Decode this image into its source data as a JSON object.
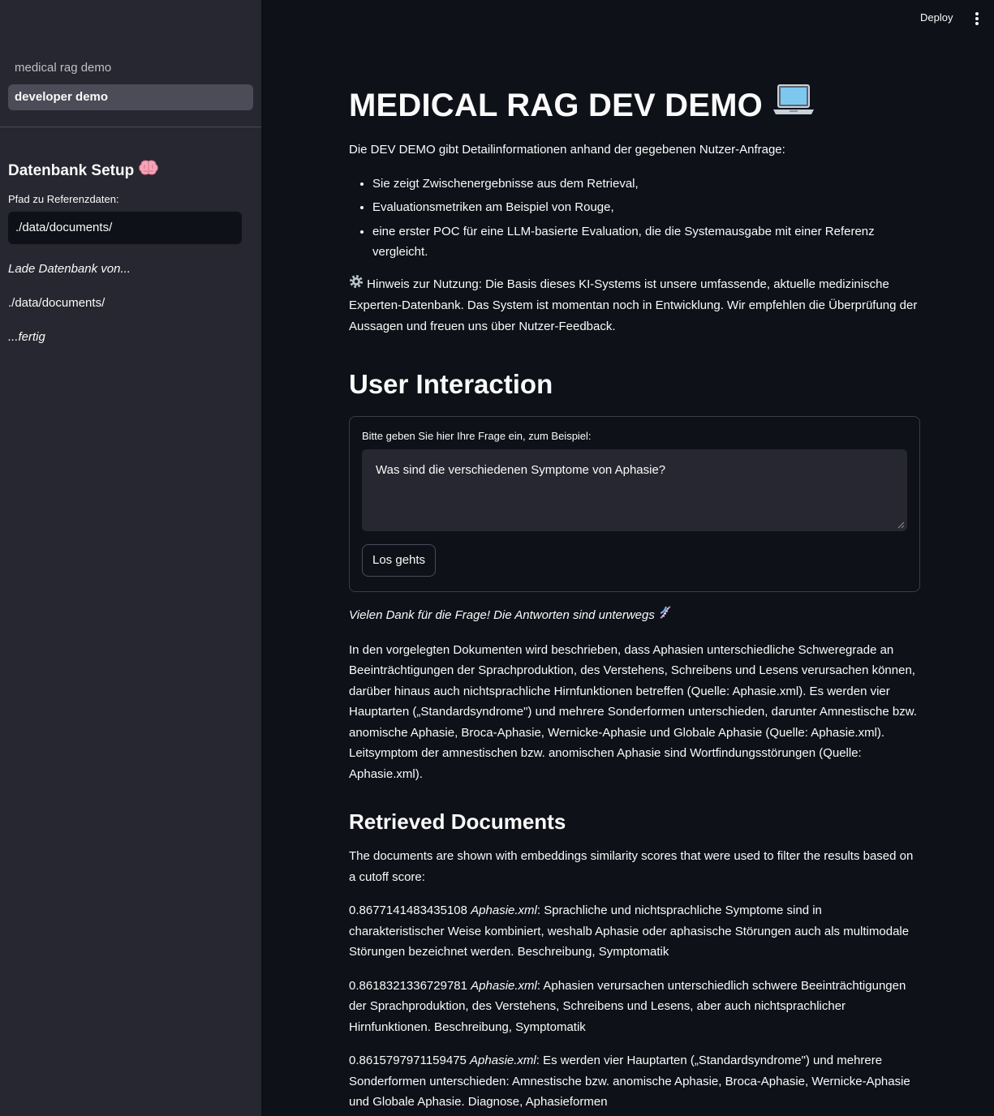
{
  "sidebar": {
    "nav": [
      {
        "label": "medical rag demo",
        "active": false
      },
      {
        "label": "developer demo",
        "active": true
      }
    ],
    "setup_heading": "Datenbank Setup",
    "setup_icon": "brain-icon",
    "path_label": "Pfad zu Referenzdaten:",
    "path_value": "./data/documents/",
    "loading_text": "Lade Datenbank von...",
    "loaded_path": "./data/documents/",
    "done_text": "...fertig"
  },
  "header": {
    "deploy_label": "Deploy",
    "menu_icon": "vertical-dots-icon"
  },
  "main": {
    "title": "MEDICAL RAG DEV DEMO",
    "title_icon": "laptop-icon",
    "intro": "Die DEV DEMO gibt Detailinformationen anhand der gegebenen Nutzer-Anfrage:",
    "bullets": [
      "Sie zeigt Zwischenergebnisse aus dem Retrieval,",
      "Evaluationsmetriken am Beispiel von Rouge,",
      "eine erster POC für eine LLM-basierte Evaluation, die die Systemausgabe mit einer Referenz vergleicht."
    ],
    "note_icon": "gear-icon",
    "note": "Hinweis zur Nutzung: Die Basis dieses KI-Systems ist unsere umfassende, aktuelle medizinische Experten-Datenbank. Das System ist momentan noch in Entwicklung. Wir empfehlen die Überprüfung der Aussagen und freuen uns über Nutzer-Feedback.",
    "interaction_heading": "User Interaction",
    "question_label": "Bitte geben Sie hier Ihre Frage ein, zum Beispiel:",
    "question_value": "Was sind die verschiedenen Symptome von Aphasie?",
    "submit_label": "Los gehts",
    "thanks": "Vielen Dank für die Frage! Die Antworten sind unterwegs",
    "thanks_icon": "dna-icon",
    "answer": "In den vorgelegten Dokumenten wird beschrieben, dass Aphasien unterschiedliche Schweregrade an Beeinträchtigungen der Sprachproduktion, des Verstehens, Schreibens und Lesens verursachen können, darüber hinaus auch nichtsprachliche Hirnfunktionen betreffen (Quelle: Aphasie.xml). Es werden vier Hauptarten („Standardsyndrome\") und mehrere Sonderformen unterschieden, darunter Amnestische bzw. anomische Aphasie, Broca-Aphasie, Wernicke-Aphasie und Globale Aphasie (Quelle: Aphasie.xml). Leitsymptom der amnestischen bzw. anomischen Aphasie sind Wortfindungsstörungen (Quelle: Aphasie.xml).",
    "retrieved_heading": "Retrieved Documents",
    "retrieved_intro": "The documents are shown with embeddings similarity scores that were used to filter the results based on a cutoff score:",
    "documents": [
      {
        "score": "0.8677141483435108",
        "file": "Aphasie.xml",
        "text": ": Sprachliche und nichtsprachliche Symptome sind in charakteristischer Weise kombiniert, weshalb Aphasie oder aphasische Störungen auch als multimodale Störungen bezeichnet werden. Beschreibung, Symptomatik"
      },
      {
        "score": "0.8618321336729781",
        "file": "Aphasie.xml",
        "text": ": Aphasien verursachen unterschiedlich schwere Beeinträchtigungen der Sprachproduktion, des Verstehens, Schreibens und Lesens, aber auch nichtsprachlicher Hirnfunktionen. Beschreibung, Symptomatik"
      },
      {
        "score": "0.8615797971159475",
        "file": "Aphasie.xml",
        "text": ": Es werden vier Hauptarten („Standardsyndrome\") und mehrere Sonderformen unterschieden: Amnestische bzw. anomische Aphasie, Broca-Aphasie, Wernicke-Aphasie und Globale Aphasie. Diagnose, Aphasieformen"
      }
    ]
  }
}
